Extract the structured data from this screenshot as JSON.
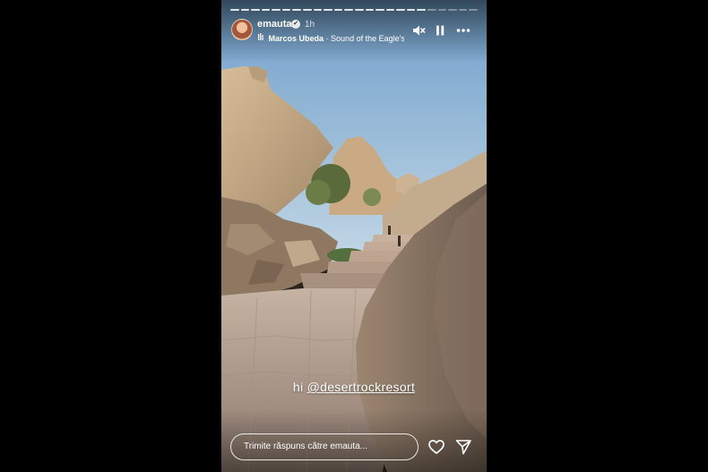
{
  "story": {
    "username": "emauta",
    "verified": "✔",
    "time": "1h",
    "music_artist": "Marcos Ubeda",
    "music_separator": " · ",
    "music_title": "Sound of the Eagle's S",
    "progress_segments": 24,
    "progress_completed": 19,
    "caption_prefix": "hi ",
    "caption_mention": "@desertrockresort",
    "reply_placeholder": "Trimite răspuns către emauta..."
  },
  "icons": {
    "mute": "speaker-muted-icon",
    "pause": "pause-icon",
    "more": "more-horizontal-icon",
    "like": "heart-icon",
    "share": "paper-plane-icon",
    "music": "music-note-icon"
  },
  "colors": {
    "sky": "#8fb8d8",
    "rock": "#c9ad8a",
    "background": "#000000"
  }
}
